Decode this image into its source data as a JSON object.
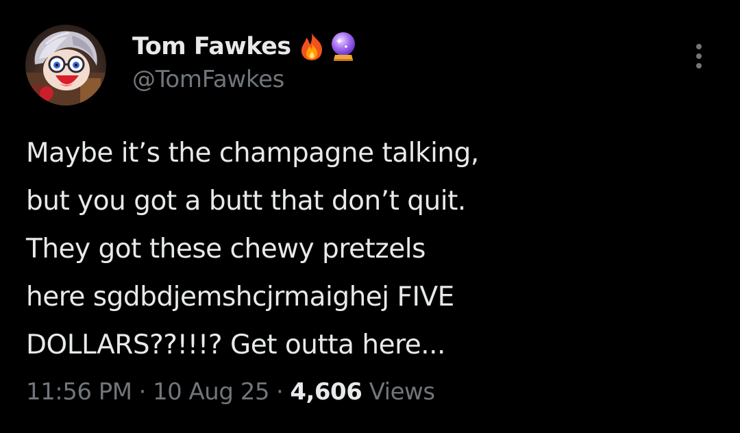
{
  "author": {
    "display_name": "Tom Fawkes",
    "handle": "@TomFawkes",
    "badges": [
      "fire-emoji",
      "crystal-ball-emoji"
    ]
  },
  "tweet": {
    "text": "Maybe it’s the champagne talking,\nbut you got a butt that don’t quit.\nThey got these chewy pretzels\nhere sgdbdjemshcjrmaighej FIVE\nDOLLARS??!!!? Get outta here..."
  },
  "meta": {
    "time": "11:56 PM",
    "separator": "·",
    "date": "10 Aug 25",
    "views_count": "4,606",
    "views_label": "Views"
  },
  "icons": {
    "more": "more-options-icon"
  },
  "colors": {
    "background": "#000000",
    "text_primary": "#e7e9ea",
    "text_secondary": "#71767b"
  }
}
